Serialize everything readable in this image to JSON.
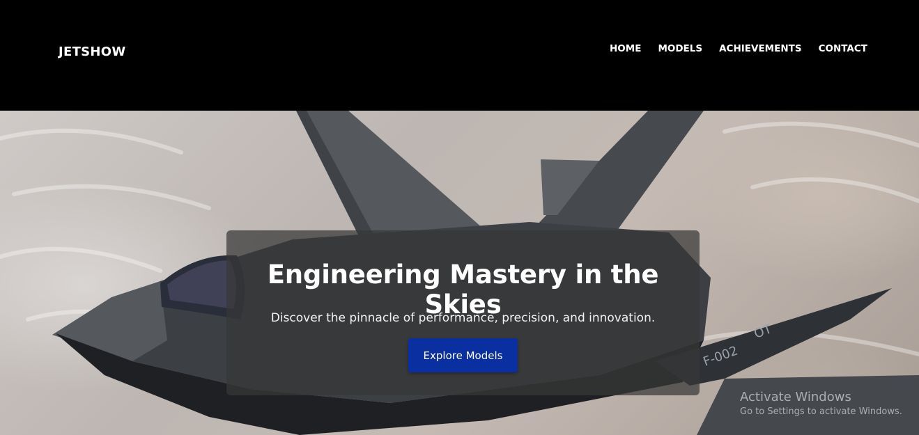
{
  "header": {
    "logo": "JETSHOW",
    "nav": [
      "HOME",
      "MODELS",
      "ACHIEVEMENTS",
      "CONTACT"
    ]
  },
  "hero": {
    "title": "Engineering Mastery in the Skies",
    "subtitle": "Discover the pinnacle of performance, precision, and innovation.",
    "cta_label": "Explore Models",
    "background_image": "fighter-jet-photo",
    "tail_markings": [
      "OT",
      "F-002"
    ]
  },
  "watermark": {
    "line1": "Activate Windows",
    "line2": "Go to Settings to activate Windows."
  },
  "colors": {
    "header_bg": "#000000",
    "cta_bg": "#0a2fa0",
    "overlay_bg": "rgba(55,55,55,0.72)"
  }
}
